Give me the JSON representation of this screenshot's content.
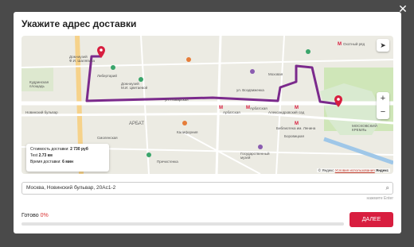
{
  "overlay": {
    "close_glyph": "✕"
  },
  "modal": {
    "title": "Укажите адрес доставки",
    "map": {
      "locate_glyph": "➤",
      "zoom_in": "+",
      "zoom_out": "−",
      "labels": {
        "dolgorukov": "Дом-музей\nФ.И. Шаляпина",
        "libertariy": "Либертарий",
        "kudrinskaya": "Кудринская\nплощадь",
        "novinsky": "Новинский бульвар",
        "ul_zagad": "ул. Поварская",
        "book_house": "Дом-музей\nМ.И. Цветаевой",
        "arbat_street": "АРБАТ",
        "arbatskaya": "Арбатская",
        "arbatskaya2": "Арбатская",
        "aleksandrovsky": "Александровский сад",
        "biblioteka": "Библиотека им. Ленина",
        "borovitskaya": "Боровицкая",
        "okhotny": "Охотный ряд",
        "kremlin": "МОСКОВСКИЙ\nКРЕМЛЬ",
        "vozdvizhenka": "ул. Воздвиженка",
        "smolensk": "Смоленская",
        "kalifornia": "Калифорния",
        "mokhovaya": "Моховая",
        "gallery": "Государственный\nмузей",
        "prechistenka": "Пречистенка"
      },
      "info": {
        "cost_label": "Стоимость доставки:",
        "cost_value": "2 730 руб",
        "test_label": "Test",
        "test_value": "2.73 км",
        "time_label": "Время доставки:",
        "time_value": "6 мин"
      },
      "copyright": {
        "yandex": "© Яндекс",
        "terms": "Условия использования",
        "brand": "Яндекс"
      }
    },
    "address": {
      "value": "Москва, Новинский бульвар, 20Ас1-2",
      "search_glyph": "⌕",
      "hint": "нажмите Enter"
    },
    "status": {
      "label": "Готово",
      "percent": "0%",
      "progress": 0
    },
    "next_button": "ДАЛЕЕ"
  },
  "colors": {
    "accent": "#d81e3f",
    "route": "#7b2a8c",
    "park": "#cfe6b8"
  }
}
